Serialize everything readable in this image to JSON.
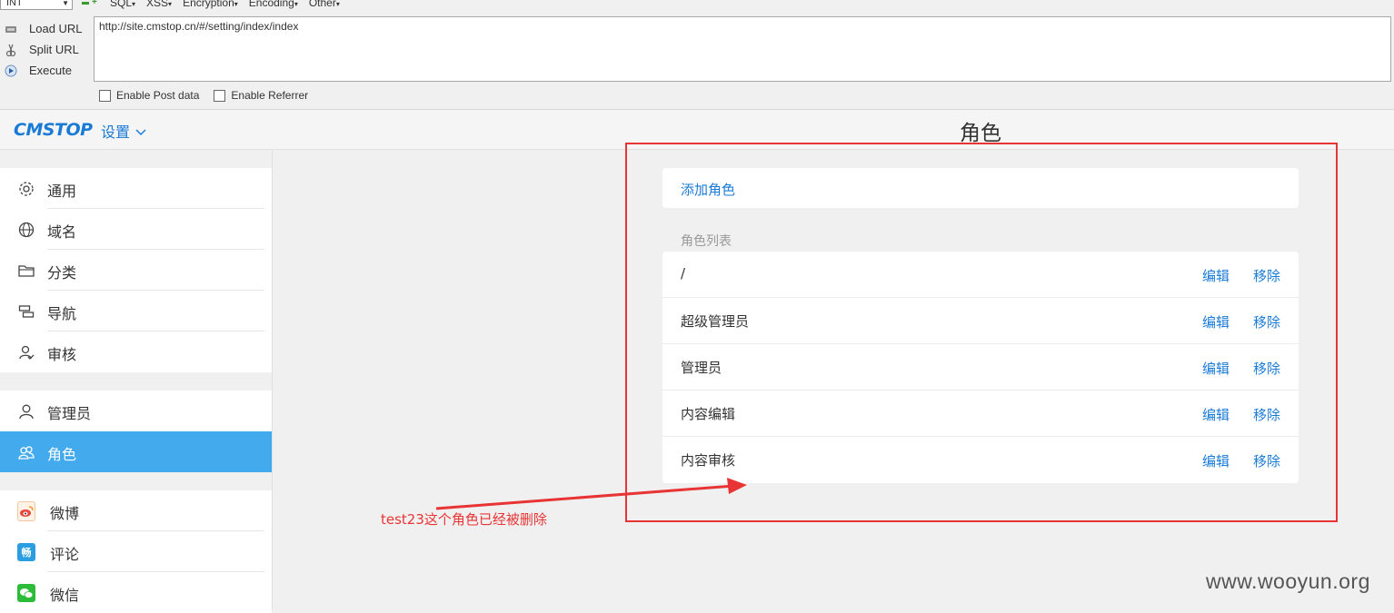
{
  "hackbar": {
    "select_value": "INT",
    "menus": [
      "SQL",
      "XSS",
      "Encryption",
      "Encoding",
      "Other"
    ],
    "buttons": {
      "load": "Load URL",
      "split": "Split URL",
      "execute": "Execute"
    },
    "url": "http://site.cmstop.cn/#/setting/index/index",
    "checks": {
      "post": "Enable Post data",
      "referrer": "Enable Referrer"
    }
  },
  "header": {
    "logo": "CMSTOP",
    "settings_label": "设置",
    "page_title": "角色"
  },
  "sidebar": {
    "group1": [
      {
        "label": "通用",
        "icon": "gear-icon"
      },
      {
        "label": "域名",
        "icon": "globe-icon"
      },
      {
        "label": "分类",
        "icon": "folder-icon"
      },
      {
        "label": "导航",
        "icon": "navigation-icon"
      },
      {
        "label": "审核",
        "icon": "user-check-icon"
      }
    ],
    "group2": [
      {
        "label": "管理员",
        "icon": "user-icon"
      },
      {
        "label": "角色",
        "icon": "users-icon"
      }
    ],
    "group3": [
      {
        "label": "微博",
        "icon": "weibo-icon"
      },
      {
        "label": "评论",
        "icon": "comment-icon",
        "badge": "畅"
      },
      {
        "label": "微信",
        "icon": "wechat-icon"
      }
    ]
  },
  "main": {
    "add_role": "添加角色",
    "list_title": "角色列表",
    "edit_label": "编辑",
    "remove_label": "移除",
    "roles": [
      "/",
      "超级管理员",
      "管理员",
      "内容编辑",
      "内容审核"
    ]
  },
  "annotation": {
    "text": "test23这个角色已经被删除",
    "color": "#e83434"
  },
  "watermark": "www.wooyun.org",
  "colors": {
    "accent": "#1a7bd6",
    "active": "#44aaee",
    "annotation": "#e83434"
  }
}
